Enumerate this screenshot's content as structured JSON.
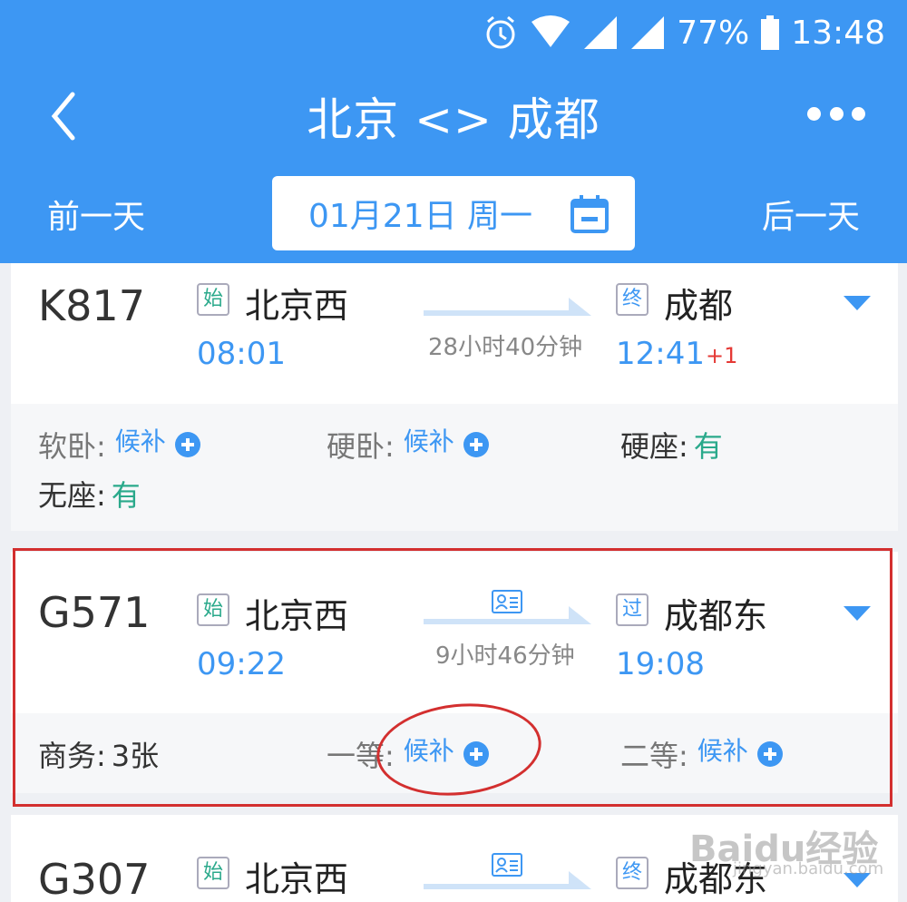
{
  "status_bar": {
    "battery": "77%",
    "time": "13:48",
    "icons": [
      "alarm-icon",
      "wifi-icon",
      "signal-icon",
      "signal-icon",
      "battery-icon"
    ]
  },
  "header": {
    "title": "北京 <> 成都",
    "prev_day": "前一天",
    "next_day": "后一天",
    "date": "01月21日 周一"
  },
  "trains": [
    {
      "number": "K817",
      "from_badge": "始",
      "from": "北京西",
      "depart": "08:01",
      "duration": "28小时40分钟",
      "to_badge": "终",
      "to": "成都",
      "arrive": "12:41",
      "day_offset": "+1",
      "seats": [
        {
          "label": "软卧:",
          "value": "候补"
        },
        {
          "label": "硬卧:",
          "value": "候补"
        },
        {
          "label": "硬座:",
          "value": "有"
        },
        {
          "label": "无座:",
          "value": "有"
        }
      ]
    },
    {
      "number": "G571",
      "from_badge": "始",
      "from": "北京西",
      "depart": "09:22",
      "duration": "9小时46分钟",
      "to_badge": "过",
      "to": "成都东",
      "arrive": "19:08",
      "seats": [
        {
          "label": "商务:",
          "value": "3张"
        },
        {
          "label": "一等:",
          "value": "候补"
        },
        {
          "label": "二等:",
          "value": "候补"
        }
      ]
    },
    {
      "number": "G307",
      "from_badge": "始",
      "from": "北京西",
      "to_badge": "终",
      "to": "成都东"
    }
  ],
  "colors": {
    "header_blue": "#3d97f3",
    "available_green": "#2aa98b",
    "highlight_red": "#d32f2f"
  },
  "watermark": {
    "text": "Baidu经验",
    "url": "jingyan.baidu.com"
  }
}
